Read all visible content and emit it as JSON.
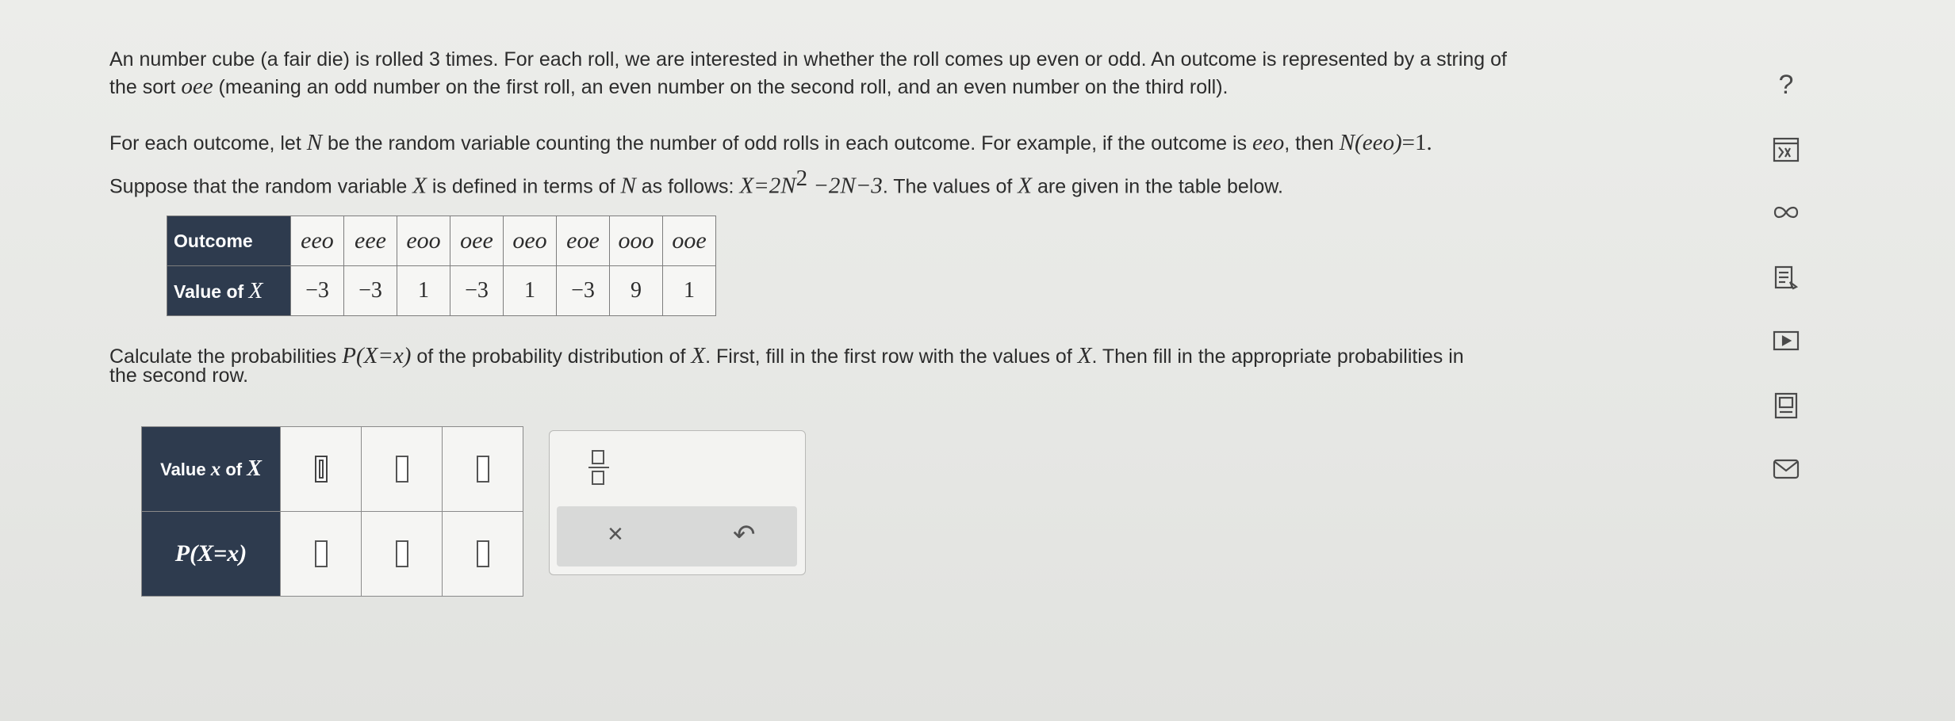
{
  "problem": {
    "p1_line1": "An number cube (a fair die) is rolled 3 times. For each roll, we are interested in whether the roll comes up even or odd. An outcome is represented by a string of",
    "p1_line2a": "the sort ",
    "p1_line2_math": "oee",
    "p1_line2b": " (meaning an odd number on the first roll, an even number on the second roll, and an even number on the third roll).",
    "p2_a": "For each outcome, let ",
    "p2_N": "N",
    "p2_b": " be the random variable counting the number of odd rolls in each outcome. For example, if the outcome is ",
    "p2_eeo": "eeo",
    "p2_c": ", then ",
    "p2_expr": "N(eeo)",
    "p2_eq": "=1.",
    "p3_a": "Suppose that the random variable ",
    "p3_X": "X",
    "p3_b": " is defined in terms of ",
    "p3_N": "N",
    "p3_c": " as follows: ",
    "p3_formula_a": "X=2N",
    "p3_formula_sup": "2",
    "p3_formula_b": " −2N−3",
    "p3_d": ". The values of ",
    "p3_X2": "X",
    "p3_e": " are given in the table below.",
    "p4_a": "Calculate the probabilities ",
    "p4_P": "P(X=x)",
    "p4_b": " of the probability distribution of ",
    "p4_X": "X",
    "p4_c": ". First, fill in the first row with the values of ",
    "p4_X2": "X",
    "p4_d": ". Then fill in the appropriate probabilities in",
    "p4_line2": "the second row."
  },
  "outcome_table": {
    "header_outcome": "Outcome",
    "header_value": "Value of ",
    "header_value_var": "X",
    "outcomes": [
      "eeo",
      "eee",
      "eoo",
      "oee",
      "oeo",
      "eoe",
      "ooo",
      "ooe"
    ],
    "values": [
      "−3",
      "−3",
      "1",
      "−3",
      "1",
      "−3",
      "9",
      "1"
    ]
  },
  "answer_table": {
    "row1_label": "Value ",
    "row1_var": "x",
    "row1_of": " of ",
    "row1_X": "X",
    "row2_label": "P(X=x)",
    "row1_inputs": [
      "",
      "",
      ""
    ],
    "row2_inputs": [
      "",
      "",
      ""
    ]
  },
  "palette": {
    "fraction_icon": "fraction-icon",
    "clear_label": "×",
    "undo_label": "↶"
  },
  "sidebar": {
    "help_label": "?",
    "icons": [
      "question-icon",
      "calculator-formula-icon",
      "infinity-icon",
      "notes-icon",
      "video-icon",
      "ebook-icon",
      "mail-icon"
    ]
  }
}
